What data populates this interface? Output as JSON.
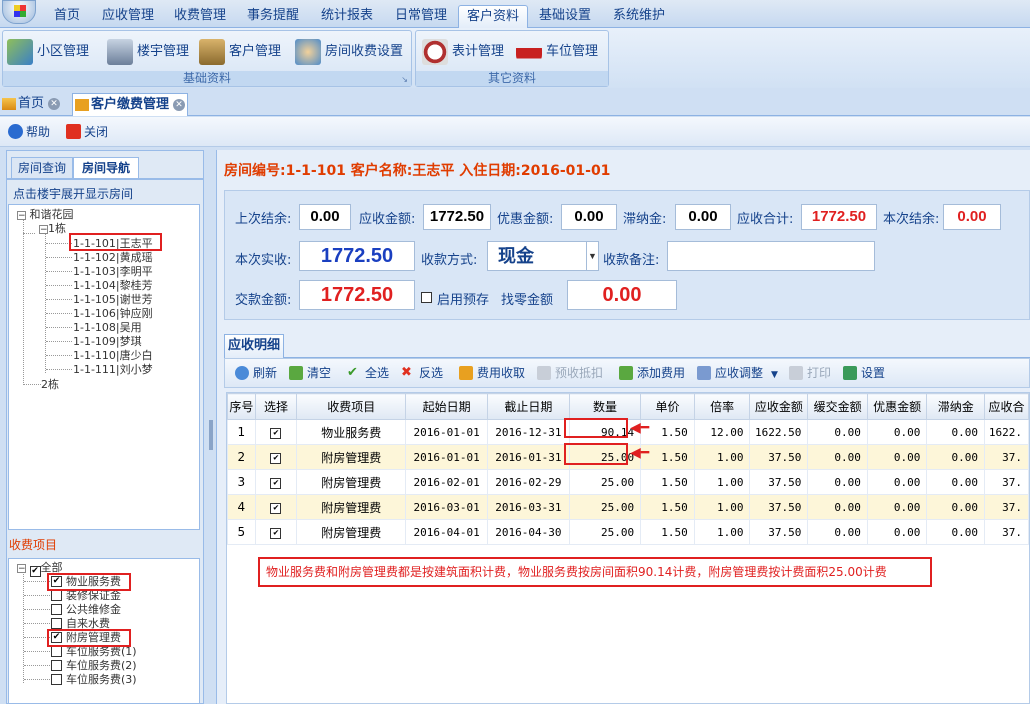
{
  "menu": {
    "tabs": [
      "首页",
      "应收管理",
      "收费管理",
      "事务提醒",
      "统计报表",
      "日常管理",
      "客户资料",
      "基础设置",
      "系统维护"
    ],
    "active": "客户资料"
  },
  "ribbon": {
    "group1": {
      "label": "基础资料",
      "buttons": [
        "小区管理",
        "楼宇管理",
        "客户管理",
        "房间收费设置"
      ]
    },
    "group2": {
      "label": "其它资料",
      "buttons": [
        "表计管理",
        "车位管理"
      ]
    }
  },
  "doc_tabs": {
    "home": "首页",
    "active": "客户缴费管理"
  },
  "toolbar": {
    "help": "帮助",
    "close": "关闭"
  },
  "left": {
    "tab_query": "房间查询",
    "tab_nav": "房间导航",
    "hint": "点击楼宇展开显示房间",
    "tree_root": "和谐花园",
    "building1": "1栋",
    "building2": "2栋",
    "rooms": [
      "1-1-101|王志平",
      "1-1-102|黄成瑶",
      "1-1-103|李明平",
      "1-1-104|黎桂芳",
      "1-1-105|谢世芳",
      "1-1-106|钟应刚",
      "1-1-108|吴用",
      "1-1-109|梦琪",
      "1-1-110|唐少白",
      "1-1-111|刘小梦"
    ],
    "fee_title": "收费项目",
    "fee_all": "全部",
    "fees": [
      {
        "label": "物业服务费",
        "checked": true
      },
      {
        "label": "装修保证金",
        "checked": false
      },
      {
        "label": "公共维修金",
        "checked": false
      },
      {
        "label": "自来水费",
        "checked": false
      },
      {
        "label": "附房管理费",
        "checked": true
      },
      {
        "label": "车位服务费(1)",
        "checked": false
      },
      {
        "label": "车位服务费(2)",
        "checked": false
      },
      {
        "label": "车位服务费(3)",
        "checked": false
      }
    ]
  },
  "info": {
    "line": "房间编号:1-1-101 客户名称:王志平 入住日期:2016-01-01"
  },
  "form": {
    "last_balance_label": "上次结余:",
    "last_balance": "0.00",
    "receivable_label": "应收金额:",
    "receivable": "1772.50",
    "discount_label": "优惠金额:",
    "discount": "0.00",
    "late_fee_label": "滞纳金:",
    "late_fee": "0.00",
    "total_label": "应收合计:",
    "total": "1772.50",
    "this_balance_label": "本次结余:",
    "this_balance": "0.00",
    "actual_label": "本次实收:",
    "actual": "1772.50",
    "method_label": "收款方式:",
    "method": "现金",
    "remark_label": "收款备注:",
    "remark": "",
    "paid_label": "交款金额:",
    "paid": "1772.50",
    "prepay_label": "启用预存",
    "change_label": "找零金额",
    "change": "0.00"
  },
  "detail": {
    "tab": "应收明细",
    "tools": [
      "刷新",
      "清空",
      "全选",
      "反选",
      "费用收取",
      "预收抵扣",
      "添加费用",
      "应收调整",
      "打印",
      "设置"
    ],
    "columns": [
      "序号",
      "选择",
      "收费项目",
      "起始日期",
      "截止日期",
      "数量",
      "单价",
      "倍率",
      "应收金额",
      "缓交金额",
      "优惠金额",
      "滞纳金",
      "应收合"
    ],
    "rows": [
      [
        "1",
        "物业服务费",
        "2016-01-01",
        "2016-12-31",
        "90.14",
        "1.50",
        "12.00",
        "1622.50",
        "0.00",
        "0.00",
        "0.00",
        "1622."
      ],
      [
        "2",
        "附房管理费",
        "2016-01-01",
        "2016-01-31",
        "25.00",
        "1.50",
        "1.00",
        "37.50",
        "0.00",
        "0.00",
        "0.00",
        "37."
      ],
      [
        "3",
        "附房管理费",
        "2016-02-01",
        "2016-02-29",
        "25.00",
        "1.50",
        "1.00",
        "37.50",
        "0.00",
        "0.00",
        "0.00",
        "37."
      ],
      [
        "4",
        "附房管理费",
        "2016-03-01",
        "2016-03-31",
        "25.00",
        "1.50",
        "1.00",
        "37.50",
        "0.00",
        "0.00",
        "0.00",
        "37."
      ],
      [
        "5",
        "附房管理费",
        "2016-04-01",
        "2016-04-30",
        "25.00",
        "1.50",
        "1.00",
        "37.50",
        "0.00",
        "0.00",
        "0.00",
        "37."
      ]
    ],
    "check_mark": "✔",
    "note": "物业服务费和附房管理费都是按建筑面积计费，物业服务费按房间面积90.14计费，附房管理费按计费面积25.00计费"
  },
  "colors": {
    "accent_red": "#e02020",
    "value_blue": "#1a3fc0",
    "title_orange": "#e03c00"
  }
}
